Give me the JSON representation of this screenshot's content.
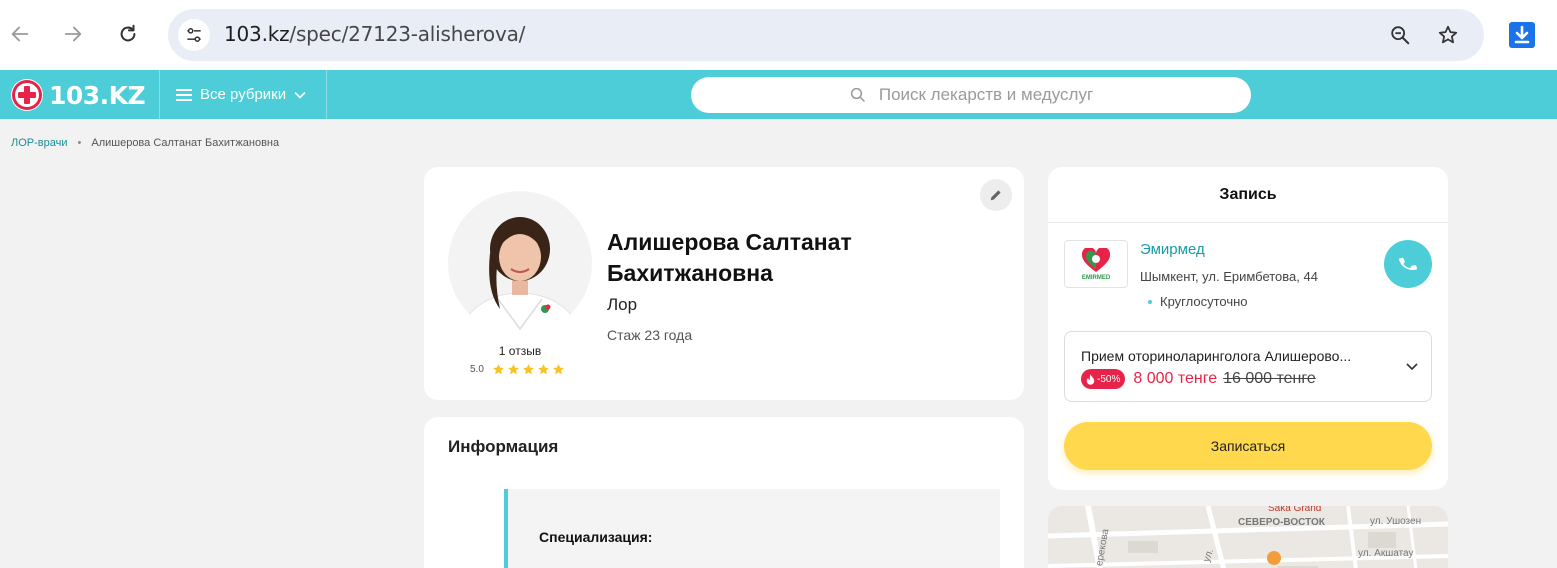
{
  "browser": {
    "url_host": "103.kz",
    "url_path": "/spec/27123-alisherova/"
  },
  "header": {
    "logo_text": "103.KZ",
    "rubrics_label": "Все рубрики",
    "search_placeholder": "Поиск лекарств и медуслуг"
  },
  "breadcrumb": {
    "parent": "ЛОР-врачи",
    "current": "Алишерова Салтанат Бахитжановна"
  },
  "profile": {
    "name": "Алишерова Салтанат Бахитжановна",
    "specialty": "Лор",
    "experience": "Стаж 23 года",
    "reviews": "1 отзыв",
    "rating": "5.0",
    "stars": 5
  },
  "info": {
    "title": "Информация",
    "spec_label": "Специализация:"
  },
  "booking": {
    "title": "Запись",
    "clinic_name": "Эмирмед",
    "clinic_logo_text": "EMIRMED",
    "clinic_address": "Шымкент, ул. Еримбетова, 44",
    "clinic_hours": "Круглосуточно",
    "service_name": "Прием оториноларинголога Алишерово...",
    "discount": "-50%",
    "price_new": "8 000 тенге",
    "price_old": "16 000 тенге",
    "book_label": "Записаться"
  },
  "map": {
    "labels": [
      "Saka Grand",
      "СЕВЕРО-ВОСТОК",
      "ул. Ушозен",
      "ул. Акшатау",
      "ерекова",
      "ул."
    ]
  },
  "colors": {
    "brand": "#4dcdd8",
    "accent_yellow": "#ffd84d",
    "price_red": "#e8234a",
    "link": "#1a9aa6"
  }
}
